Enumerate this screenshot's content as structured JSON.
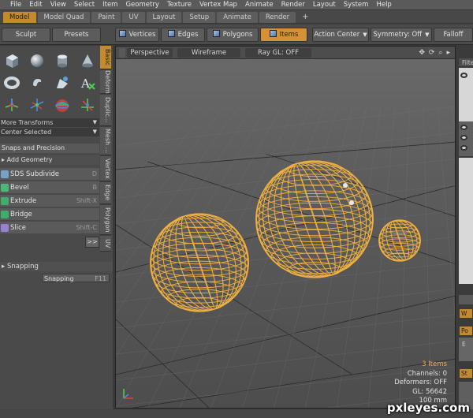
{
  "menu": [
    "File",
    "Edit",
    "View",
    "Select",
    "Item",
    "Geometry",
    "Texture",
    "Vertex Map",
    "Animate",
    "Render",
    "Layout",
    "System",
    "Help"
  ],
  "layout_tabs": {
    "items": [
      "Model",
      "Model Quad",
      "Paint",
      "UV",
      "Layout",
      "Setup",
      "Animate",
      "Render"
    ],
    "active": "Model",
    "add_label": "+"
  },
  "toolbar": {
    "sculpt": "Sculpt",
    "presets": "Presets",
    "vertices": "Vertices",
    "edges": "Edges",
    "polygons": "Polygons",
    "items": "Items",
    "action_center": "Action Center",
    "symmetry": "Symmetry: Off",
    "falloff": "Falloff"
  },
  "left_tabs": [
    "Basic",
    "Deform",
    "Duplic...",
    "Mesh ...",
    "Vertex",
    "Edge",
    "Polygon",
    "UV"
  ],
  "left_panel": {
    "more_transforms": "More Transforms",
    "center_selected": "Center Selected",
    "snaps_precision": "Snaps and Precision",
    "add_geometry": "Add Geometry",
    "tools": [
      {
        "label": "SDS Subdivide",
        "key": "D"
      },
      {
        "label": "Bevel",
        "key": "B"
      },
      {
        "label": "Extrude",
        "key": "Shift-X"
      },
      {
        "label": "Bridge",
        "key": ""
      },
      {
        "label": "Slice",
        "key": "Shift-C"
      }
    ],
    "expander": ">>",
    "snapping_header": "Snapping",
    "snapping_button": "Snapping",
    "snapping_key": "F11"
  },
  "viewport": {
    "view_mode": "Perspective",
    "shading": "Wireframe",
    "raygl": "Ray GL: OFF",
    "info": {
      "items": "3 Items",
      "channels": "Channels: 0",
      "deformers": "Deformers: OFF",
      "gl": "GL: 56642",
      "scale": "100 mm"
    }
  },
  "right_panel": {
    "filter": "Filte",
    "w": "W",
    "po": "Po",
    "e": "E",
    "st": "St"
  },
  "colors": {
    "accent": "#c48a2e",
    "wire": "#f0b040",
    "background": "#3a3a3a"
  },
  "watermark": "pxleyes.com"
}
